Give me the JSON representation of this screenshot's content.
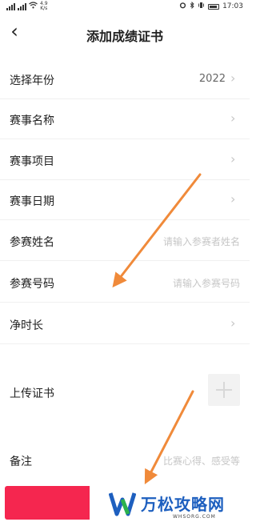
{
  "status_bar": {
    "network_speed": "4.9",
    "speed_unit": "K/s",
    "time": "17:03"
  },
  "header": {
    "back_glyph": "‹",
    "title": "添加成绩证书"
  },
  "form": {
    "year": {
      "label": "选择年份",
      "value": "2022"
    },
    "event_name": {
      "label": "赛事名称"
    },
    "event_item": {
      "label": "赛事项目"
    },
    "event_date": {
      "label": "赛事日期"
    },
    "participant_name": {
      "label": "参赛姓名",
      "placeholder": "请输入参赛者姓名"
    },
    "participant_number": {
      "label": "参赛号码",
      "placeholder": "请输入参赛号码"
    },
    "net_time": {
      "label": "净时长"
    },
    "upload_certificate": {
      "label": "上传证书"
    },
    "remarks": {
      "label": "备注",
      "placeholder": "比赛心得、感受等"
    }
  },
  "watermark": {
    "brand": "万松攻略网",
    "domain": "WHSORG.COM"
  },
  "colors": {
    "submit_button": "#f5264f",
    "annotation_arrow": "#f08a3a",
    "watermark_blue": "#1d5fbf",
    "watermark_green": "#2bb24c"
  }
}
